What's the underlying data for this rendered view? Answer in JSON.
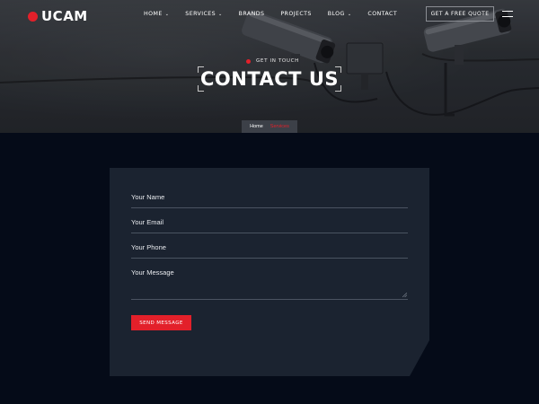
{
  "colors": {
    "accent": "#e3202a",
    "page_background": "#050b18",
    "card_background": "#1b2330",
    "hero_background": "#2b2e33"
  },
  "brand": {
    "name": "UCAM"
  },
  "nav": {
    "items": [
      {
        "label": "HOME",
        "has_dropdown": true
      },
      {
        "label": "SERVICES",
        "has_dropdown": true
      },
      {
        "label": "BRANDS",
        "has_dropdown": false
      },
      {
        "label": "PROJECTS",
        "has_dropdown": false
      },
      {
        "label": "BLOG",
        "has_dropdown": true
      },
      {
        "label": "CONTACT",
        "has_dropdown": false
      }
    ],
    "quote_button": "GET A FREE QUOTE",
    "menu_icon": "hamburger-icon"
  },
  "hero": {
    "subtitle": "GET IN TOUCH",
    "title": "CONTACT US",
    "breadcrumb": {
      "home": "Home",
      "current": "Services"
    }
  },
  "form": {
    "fields": [
      {
        "label": "Your Name",
        "value": ""
      },
      {
        "label": "Your Email",
        "value": ""
      },
      {
        "label": "Your Phone",
        "value": ""
      },
      {
        "label": "Your Message",
        "value": ""
      }
    ],
    "submit": "SEND MESSAGE"
  }
}
